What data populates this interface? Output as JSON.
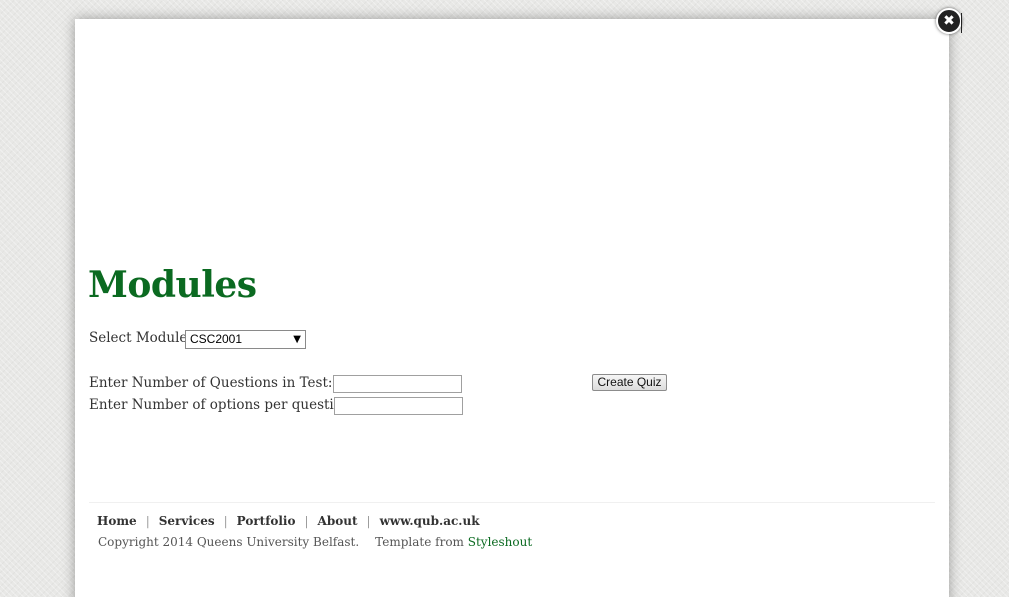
{
  "page": {
    "title": "Modules"
  },
  "close_button": {
    "glyph": "✖",
    "icon": "close-icon"
  },
  "form": {
    "module_label": "Select Module:",
    "module_selected": "CSC2001",
    "questions_label": "Enter Number of Questions in Test:",
    "questions_value": "",
    "options_label": "Enter Number of options per question:",
    "options_value": "",
    "create_button": "Create Quiz"
  },
  "footer": {
    "nav": [
      "Home",
      "Services",
      "Portfolio",
      "About",
      "www.qub.ac.uk"
    ],
    "separator": "|",
    "copyright": "Copyright 2014 Queens University Belfast.",
    "template_prefix": "Template from",
    "template_link": "Styleshout"
  },
  "colors": {
    "title_green": "#0b6a21",
    "background": "#e8e8e6",
    "modal": "#ffffff"
  }
}
